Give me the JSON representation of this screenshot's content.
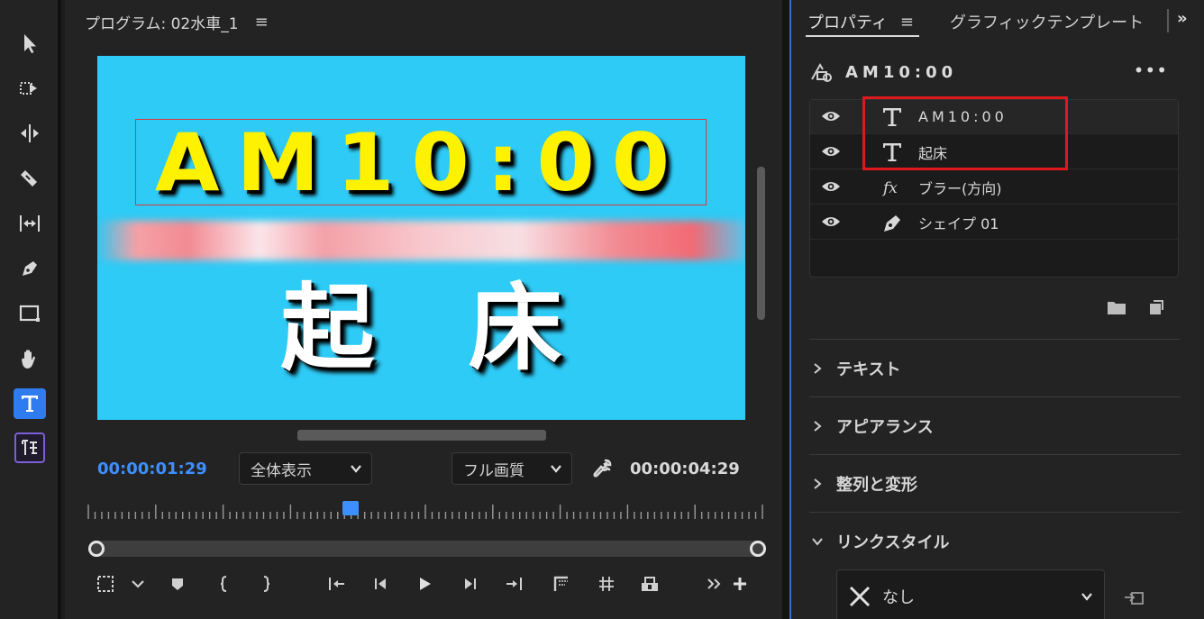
{
  "tools": [
    {
      "name": "selection-tool-icon"
    },
    {
      "name": "track-select-tool-icon"
    },
    {
      "name": "ripple-edit-tool-icon"
    },
    {
      "name": "razor-tool-icon"
    },
    {
      "name": "slip-tool-icon"
    },
    {
      "name": "pen-tool-icon"
    },
    {
      "name": "rectangle-tool-icon"
    },
    {
      "name": "hand-tool-icon"
    },
    {
      "name": "type-tool-icon",
      "active": true
    },
    {
      "name": "vertical-type-tool-icon"
    }
  ],
  "program": {
    "tab_title": "プログラム: 02水車_1",
    "video": {
      "title_text": "AM10:00",
      "sub_text": "起 床",
      "background_color": "#2ecbf6",
      "title_color": "#fff200"
    },
    "timecode_current": "00:00:01:29",
    "fit_label": "全体表示",
    "quality_label": "フル画質",
    "timecode_duration": "00:00:04:29",
    "playhead_fraction": 0.39
  },
  "properties": {
    "tab_active": "プロパティ",
    "tab_inactive": "グラフィックテンプレート",
    "more_tabs": "»",
    "clip_title": "AM10:00",
    "clip_menu": "•••",
    "layers": [
      {
        "label": "AM10:00",
        "icon": "text-layer-icon",
        "selected": true
      },
      {
        "label": "起床",
        "icon": "text-layer-icon",
        "selected": false
      },
      {
        "label": "ブラー(方向)",
        "icon": "fx-icon",
        "selected": false
      },
      {
        "label": "シェイプ 01",
        "icon": "shape-pen-icon",
        "selected": false
      }
    ],
    "sections": [
      {
        "label": "テキスト",
        "expanded": false
      },
      {
        "label": "アピアランス",
        "expanded": false
      },
      {
        "label": "整列と変形",
        "expanded": false
      },
      {
        "label": "リンクスタイル",
        "expanded": true
      }
    ],
    "link_style_value": "なし"
  },
  "colors": {
    "accent_blue": "#3d8fff",
    "highlight_red": "#e0181e"
  }
}
